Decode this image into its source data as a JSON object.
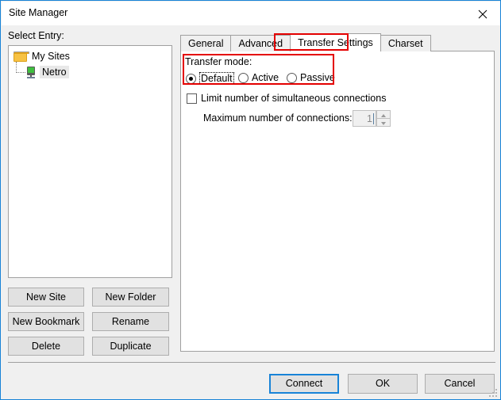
{
  "window": {
    "title": "Site Manager",
    "close_icon": "close-icon"
  },
  "left_pane": {
    "label": "Select Entry:",
    "tree": [
      {
        "label": "My Sites",
        "icon": "folder-icon",
        "selected": false
      },
      {
        "label": "Netro",
        "icon": "server-icon",
        "selected": true
      }
    ],
    "buttons": [
      {
        "label": "New Site"
      },
      {
        "label": "New Folder"
      },
      {
        "label": "New Bookmark"
      },
      {
        "label": "Rename"
      },
      {
        "label": "Delete"
      },
      {
        "label": "Duplicate"
      }
    ]
  },
  "tabs": [
    {
      "label": "General",
      "active": false
    },
    {
      "label": "Advanced",
      "active": false
    },
    {
      "label": "Transfer Settings",
      "active": true
    },
    {
      "label": "Charset",
      "active": false
    }
  ],
  "transfer_settings": {
    "group_label": "Transfer mode:",
    "radios": [
      {
        "label": "Default",
        "checked": true,
        "focused": true
      },
      {
        "label": "Active",
        "checked": false,
        "focused": false
      },
      {
        "label": "Passive",
        "checked": false,
        "focused": false
      }
    ],
    "limit_checkbox": {
      "label": "Limit number of simultaneous connections",
      "checked": false
    },
    "max_connections": {
      "label": "Maximum number of connections:",
      "value": "1",
      "enabled": false
    }
  },
  "footer": {
    "connect_label": "Connect",
    "ok_label": "OK",
    "cancel_label": "Cancel"
  },
  "colors": {
    "window_border": "#1883d7",
    "focus_blue": "#1883d7",
    "annotation_red": "#e40000",
    "dialog_bg": "#f0f0f0",
    "folder_amber": "#f7c244",
    "server_green": "#3fbf3f"
  }
}
